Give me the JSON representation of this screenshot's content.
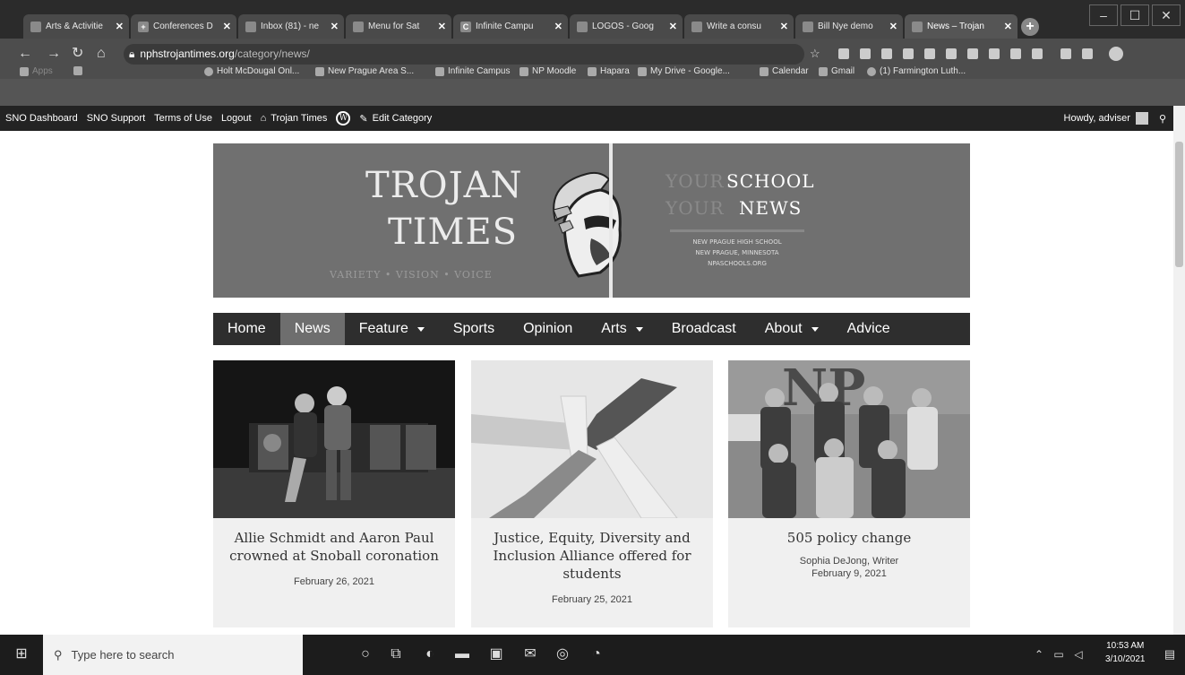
{
  "browser": {
    "tabs": [
      {
        "label": "Arts & Activitie",
        "fav": ""
      },
      {
        "label": "Conferences D",
        "fav": "+"
      },
      {
        "label": "Inbox (81) - ne",
        "fav": ""
      },
      {
        "label": "Menu for Sat",
        "fav": ""
      },
      {
        "label": "Infinite Campu",
        "fav": "C"
      },
      {
        "label": "LOGOS - Goog",
        "fav": ""
      },
      {
        "label": "Write a consu",
        "fav": ""
      },
      {
        "label": "Bill Nye demo",
        "fav": ""
      },
      {
        "label": "News – Trojan",
        "fav": ""
      }
    ],
    "url_domain": "nphstrojantimes.org",
    "url_path": "/category/news/",
    "bookmarks": [
      {
        "label": "Apps"
      },
      {
        "label": "Holt McDougal Onl..."
      },
      {
        "label": "New Prague Area S..."
      },
      {
        "label": "Infinite Campus"
      },
      {
        "label": "NP Moodle"
      },
      {
        "label": "Hapara"
      },
      {
        "label": "My Drive - Google..."
      },
      {
        "label": "Calendar"
      },
      {
        "label": "Gmail"
      },
      {
        "label": "(1) Farmington Luth..."
      }
    ]
  },
  "wp_admin": {
    "items": [
      "SNO Dashboard",
      "SNO Support",
      "Terms of Use",
      "Logout",
      "Trojan Times",
      "Edit Category"
    ],
    "howdy": "Howdy, adviser"
  },
  "banner": {
    "title_line1": "TROJAN",
    "title_line2": "TIMES",
    "motto": "VARIETY • VISION • VOICE",
    "your1": "YOUR",
    "school": "SCHOOL",
    "your2": "YOUR",
    "news": "NEWS",
    "addr1": "NEW PRAGUE HIGH SCHOOL",
    "addr2": "NEW PRAGUE, MINNESOTA",
    "addr3": "NPASCHOOLS.ORG"
  },
  "nav": [
    {
      "label": "Home"
    },
    {
      "label": "News"
    },
    {
      "label": "Feature"
    },
    {
      "label": "Sports"
    },
    {
      "label": "Opinion"
    },
    {
      "label": "Arts"
    },
    {
      "label": "Broadcast"
    },
    {
      "label": "About"
    },
    {
      "label": "Advice"
    }
  ],
  "cards": [
    {
      "title": "Allie Schmidt and Aaron Paul crowned at Snoball coronation",
      "byline": "",
      "date": "February 26, 2021"
    },
    {
      "title": "Justice, Equity, Diversity and Inclusion Alliance offered for students",
      "byline": "",
      "date": "February 25, 2021"
    },
    {
      "title": "505 policy change",
      "byline_name": "Sophia DeJong",
      "byline_role": ", Writer",
      "date": "February 9, 2021"
    }
  ],
  "taskbar": {
    "search_placeholder": "Type here to search",
    "time": "10:53 AM",
    "date": "3/10/2021"
  }
}
